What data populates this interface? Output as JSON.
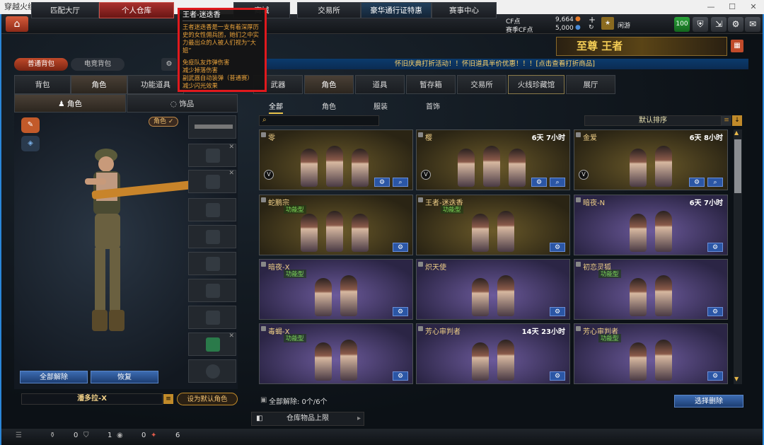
{
  "window": {
    "title": "穿越火线"
  },
  "nav": {
    "tabs": [
      "匹配大厅",
      "个人仓库",
      "商城",
      "交易所",
      "豪华通行证特惠",
      "赛事中心"
    ],
    "active": 1
  },
  "currency": {
    "cf_label": "CF点",
    "cf_value": "9,664",
    "premium_label": "赛季CF点",
    "premium_value": "5,000",
    "user": "闲游"
  },
  "top_badge": "100",
  "promo": {
    "text": "至尊 王者"
  },
  "bag": {
    "normal": "普通背包",
    "esports": "电竞背包"
  },
  "tooltip": {
    "title": "王者-迷迭香",
    "desc": "王者迷迭香是一支有着深厚历史的女性佣兵团，她们之中实力最出众的人被人们视为“大姐”",
    "perks": [
      "免疫队友炸弹伤害",
      "减少掉落伤害",
      "副武器自动装弹（普通赛）",
      "减少闪光效果"
    ]
  },
  "left_tabs": [
    "背包",
    "角色",
    "功能道具"
  ],
  "left_subtabs": [
    "角色",
    "饰品"
  ],
  "role_badge": "角色 ✓",
  "left_buttons": {
    "unequip_all": "全部解除",
    "restore": "恢复"
  },
  "char_name": "潘多拉-X",
  "set_default": "设为默认角色",
  "banner": "怀旧庆典打折活动！！怀旧道具半价优惠！！！[点击查看打折商品]",
  "main_tabs": [
    "武器",
    "角色",
    "道具",
    "暂存箱",
    "交易所",
    "火线珍藏馆",
    "展厅"
  ],
  "main_active": 1,
  "filter_tabs": [
    "全部",
    "角色",
    "服装",
    "首饰"
  ],
  "sort_label": "默认排序",
  "cards": [
    {
      "name": "零",
      "time": "",
      "style": "gold",
      "figs": 3,
      "badge": true,
      "icons": 2
    },
    {
      "name": "樱",
      "time": "6天 7小时",
      "style": "gold",
      "figs": 3,
      "badge": true,
      "icons": 2
    },
    {
      "name": "金爱",
      "time": "6天 8小时",
      "style": "gold",
      "figs": 2,
      "badge": true,
      "icons": 2
    },
    {
      "name": "蛇鹏宗",
      "time": "",
      "style": "gold",
      "figs": 3,
      "func": "功能型",
      "icons": 1
    },
    {
      "name": "王者-迷迭香",
      "time": "",
      "style": "gold",
      "figs": 2,
      "func": "功能型",
      "icons": 1
    },
    {
      "name": "暗夜-N",
      "time": "6天 7小时",
      "style": "purple",
      "figs": 2,
      "icons": 1
    },
    {
      "name": "暗夜-X",
      "time": "",
      "style": "purple",
      "figs": 2,
      "func": "功能型",
      "icons": 1
    },
    {
      "name": "炽天使",
      "time": "",
      "style": "purple",
      "figs": 2,
      "icons": 1
    },
    {
      "name": "初恋灵狐",
      "time": "",
      "style": "purple",
      "figs": 2,
      "func": "功能型",
      "icons": 1
    },
    {
      "name": "毒蝎-X",
      "time": "",
      "style": "purple",
      "figs": 2,
      "func": "功能型",
      "icons": 1
    },
    {
      "name": "芳心审判者",
      "time": "14天 23小时",
      "style": "purple",
      "figs": 2,
      "icons": 1
    },
    {
      "name": "芳心审判者",
      "time": "",
      "style": "purple",
      "figs": 2,
      "func": "功能型",
      "icons": 1
    }
  ],
  "footer": {
    "unequip_count": "全部解除: 0个/6个",
    "select_delete": "选择删除",
    "limit": "仓库物品上限"
  },
  "bottom_bar": {
    "counts": [
      "0",
      "1",
      "0",
      "6"
    ]
  }
}
